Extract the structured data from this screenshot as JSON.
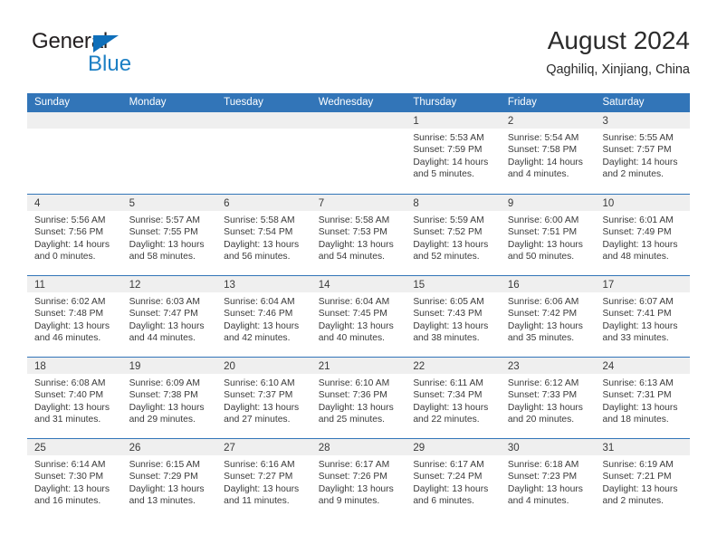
{
  "brand": {
    "name_top": "General",
    "name_bottom": "Blue",
    "triangle_icon": "triangle-icon",
    "color_dark": "#231f20",
    "color_blue": "#1c7fc4"
  },
  "header": {
    "title": "August 2024",
    "subtitle": "Qaghiliq, Xinjiang, China"
  },
  "theme": {
    "header_blue": "#3275b8",
    "day_band_gray": "#efefef",
    "text": "#3a3a3a"
  },
  "weekdays": [
    "Sunday",
    "Monday",
    "Tuesday",
    "Wednesday",
    "Thursday",
    "Friday",
    "Saturday"
  ],
  "weeks": [
    [
      {
        "empty": true
      },
      {
        "empty": true
      },
      {
        "empty": true
      },
      {
        "empty": true
      },
      {
        "day": "1",
        "sunrise": "Sunrise: 5:53 AM",
        "sunset": "Sunset: 7:59 PM",
        "daylight_line1": "Daylight: 14 hours",
        "daylight_line2": "and 5 minutes."
      },
      {
        "day": "2",
        "sunrise": "Sunrise: 5:54 AM",
        "sunset": "Sunset: 7:58 PM",
        "daylight_line1": "Daylight: 14 hours",
        "daylight_line2": "and 4 minutes."
      },
      {
        "day": "3",
        "sunrise": "Sunrise: 5:55 AM",
        "sunset": "Sunset: 7:57 PM",
        "daylight_line1": "Daylight: 14 hours",
        "daylight_line2": "and 2 minutes."
      }
    ],
    [
      {
        "day": "4",
        "sunrise": "Sunrise: 5:56 AM",
        "sunset": "Sunset: 7:56 PM",
        "daylight_line1": "Daylight: 14 hours",
        "daylight_line2": "and 0 minutes."
      },
      {
        "day": "5",
        "sunrise": "Sunrise: 5:57 AM",
        "sunset": "Sunset: 7:55 PM",
        "daylight_line1": "Daylight: 13 hours",
        "daylight_line2": "and 58 minutes."
      },
      {
        "day": "6",
        "sunrise": "Sunrise: 5:58 AM",
        "sunset": "Sunset: 7:54 PM",
        "daylight_line1": "Daylight: 13 hours",
        "daylight_line2": "and 56 minutes."
      },
      {
        "day": "7",
        "sunrise": "Sunrise: 5:58 AM",
        "sunset": "Sunset: 7:53 PM",
        "daylight_line1": "Daylight: 13 hours",
        "daylight_line2": "and 54 minutes."
      },
      {
        "day": "8",
        "sunrise": "Sunrise: 5:59 AM",
        "sunset": "Sunset: 7:52 PM",
        "daylight_line1": "Daylight: 13 hours",
        "daylight_line2": "and 52 minutes."
      },
      {
        "day": "9",
        "sunrise": "Sunrise: 6:00 AM",
        "sunset": "Sunset: 7:51 PM",
        "daylight_line1": "Daylight: 13 hours",
        "daylight_line2": "and 50 minutes."
      },
      {
        "day": "10",
        "sunrise": "Sunrise: 6:01 AM",
        "sunset": "Sunset: 7:49 PM",
        "daylight_line1": "Daylight: 13 hours",
        "daylight_line2": "and 48 minutes."
      }
    ],
    [
      {
        "day": "11",
        "sunrise": "Sunrise: 6:02 AM",
        "sunset": "Sunset: 7:48 PM",
        "daylight_line1": "Daylight: 13 hours",
        "daylight_line2": "and 46 minutes."
      },
      {
        "day": "12",
        "sunrise": "Sunrise: 6:03 AM",
        "sunset": "Sunset: 7:47 PM",
        "daylight_line1": "Daylight: 13 hours",
        "daylight_line2": "and 44 minutes."
      },
      {
        "day": "13",
        "sunrise": "Sunrise: 6:04 AM",
        "sunset": "Sunset: 7:46 PM",
        "daylight_line1": "Daylight: 13 hours",
        "daylight_line2": "and 42 minutes."
      },
      {
        "day": "14",
        "sunrise": "Sunrise: 6:04 AM",
        "sunset": "Sunset: 7:45 PM",
        "daylight_line1": "Daylight: 13 hours",
        "daylight_line2": "and 40 minutes."
      },
      {
        "day": "15",
        "sunrise": "Sunrise: 6:05 AM",
        "sunset": "Sunset: 7:43 PM",
        "daylight_line1": "Daylight: 13 hours",
        "daylight_line2": "and 38 minutes."
      },
      {
        "day": "16",
        "sunrise": "Sunrise: 6:06 AM",
        "sunset": "Sunset: 7:42 PM",
        "daylight_line1": "Daylight: 13 hours",
        "daylight_line2": "and 35 minutes."
      },
      {
        "day": "17",
        "sunrise": "Sunrise: 6:07 AM",
        "sunset": "Sunset: 7:41 PM",
        "daylight_line1": "Daylight: 13 hours",
        "daylight_line2": "and 33 minutes."
      }
    ],
    [
      {
        "day": "18",
        "sunrise": "Sunrise: 6:08 AM",
        "sunset": "Sunset: 7:40 PM",
        "daylight_line1": "Daylight: 13 hours",
        "daylight_line2": "and 31 minutes."
      },
      {
        "day": "19",
        "sunrise": "Sunrise: 6:09 AM",
        "sunset": "Sunset: 7:38 PM",
        "daylight_line1": "Daylight: 13 hours",
        "daylight_line2": "and 29 minutes."
      },
      {
        "day": "20",
        "sunrise": "Sunrise: 6:10 AM",
        "sunset": "Sunset: 7:37 PM",
        "daylight_line1": "Daylight: 13 hours",
        "daylight_line2": "and 27 minutes."
      },
      {
        "day": "21",
        "sunrise": "Sunrise: 6:10 AM",
        "sunset": "Sunset: 7:36 PM",
        "daylight_line1": "Daylight: 13 hours",
        "daylight_line2": "and 25 minutes."
      },
      {
        "day": "22",
        "sunrise": "Sunrise: 6:11 AM",
        "sunset": "Sunset: 7:34 PM",
        "daylight_line1": "Daylight: 13 hours",
        "daylight_line2": "and 22 minutes."
      },
      {
        "day": "23",
        "sunrise": "Sunrise: 6:12 AM",
        "sunset": "Sunset: 7:33 PM",
        "daylight_line1": "Daylight: 13 hours",
        "daylight_line2": "and 20 minutes."
      },
      {
        "day": "24",
        "sunrise": "Sunrise: 6:13 AM",
        "sunset": "Sunset: 7:31 PM",
        "daylight_line1": "Daylight: 13 hours",
        "daylight_line2": "and 18 minutes."
      }
    ],
    [
      {
        "day": "25",
        "sunrise": "Sunrise: 6:14 AM",
        "sunset": "Sunset: 7:30 PM",
        "daylight_line1": "Daylight: 13 hours",
        "daylight_line2": "and 16 minutes."
      },
      {
        "day": "26",
        "sunrise": "Sunrise: 6:15 AM",
        "sunset": "Sunset: 7:29 PM",
        "daylight_line1": "Daylight: 13 hours",
        "daylight_line2": "and 13 minutes."
      },
      {
        "day": "27",
        "sunrise": "Sunrise: 6:16 AM",
        "sunset": "Sunset: 7:27 PM",
        "daylight_line1": "Daylight: 13 hours",
        "daylight_line2": "and 11 minutes."
      },
      {
        "day": "28",
        "sunrise": "Sunrise: 6:17 AM",
        "sunset": "Sunset: 7:26 PM",
        "daylight_line1": "Daylight: 13 hours",
        "daylight_line2": "and 9 minutes."
      },
      {
        "day": "29",
        "sunrise": "Sunrise: 6:17 AM",
        "sunset": "Sunset: 7:24 PM",
        "daylight_line1": "Daylight: 13 hours",
        "daylight_line2": "and 6 minutes."
      },
      {
        "day": "30",
        "sunrise": "Sunrise: 6:18 AM",
        "sunset": "Sunset: 7:23 PM",
        "daylight_line1": "Daylight: 13 hours",
        "daylight_line2": "and 4 minutes."
      },
      {
        "day": "31",
        "sunrise": "Sunrise: 6:19 AM",
        "sunset": "Sunset: 7:21 PM",
        "daylight_line1": "Daylight: 13 hours",
        "daylight_line2": "and 2 minutes."
      }
    ]
  ]
}
